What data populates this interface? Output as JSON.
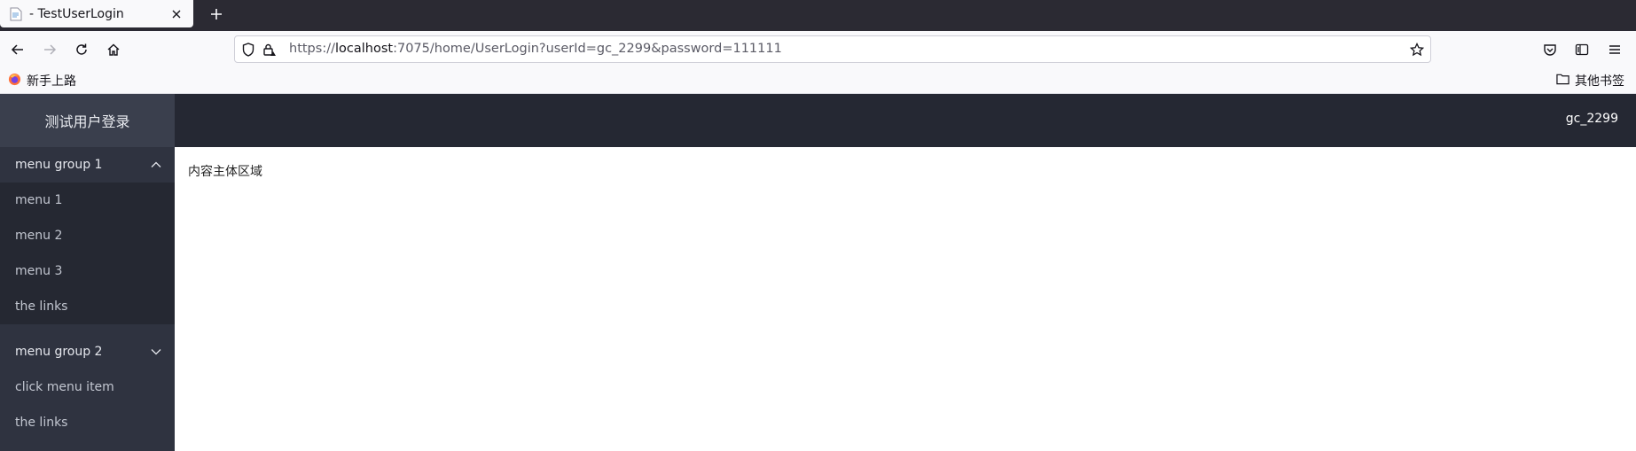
{
  "browser": {
    "tab": {
      "title": "- TestUserLogin",
      "favicon": "page-icon"
    },
    "url": {
      "scheme": "https://",
      "host": "localhost",
      "rest": ":7075/home/UserLogin?userId=gc_2299&password=111111"
    },
    "bookmarks": {
      "left_label": "新手上路",
      "right_label": "其他书签"
    }
  },
  "app": {
    "brand": "测试用户登录",
    "user": "gc_2299",
    "menu": [
      {
        "title": "menu group 1",
        "expanded": true,
        "items": [
          {
            "label": "menu 1"
          },
          {
            "label": "menu 2"
          },
          {
            "label": "menu 3"
          },
          {
            "label": "the links"
          }
        ]
      },
      {
        "title": "menu group 2",
        "expanded": false,
        "items": [
          {
            "label": "click menu item"
          },
          {
            "label": "the links"
          }
        ]
      }
    ],
    "content_text": "内容主体区域"
  },
  "colors": {
    "sidebar_bg": "#2f3340",
    "submenu_bg": "#252832",
    "header_bg": "#252833",
    "brand_bg": "#3a3f4d"
  }
}
